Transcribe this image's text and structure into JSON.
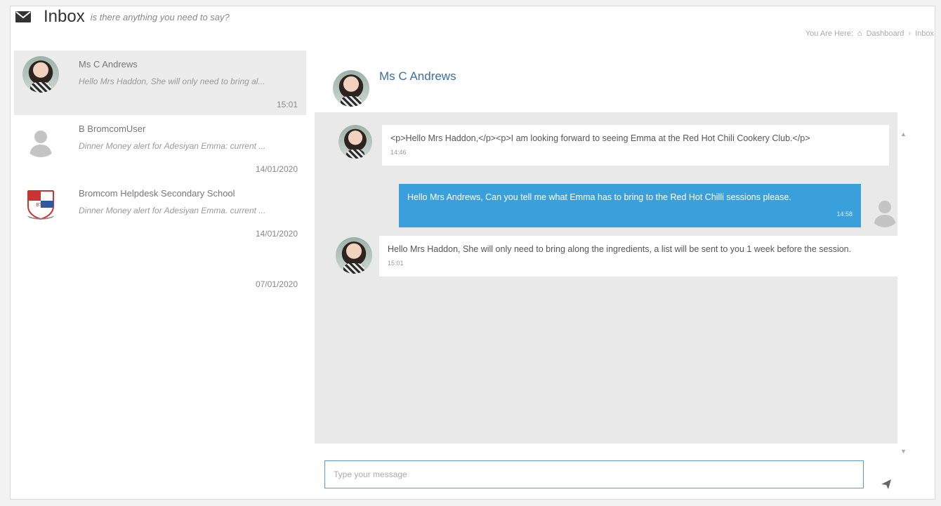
{
  "header": {
    "icon": "envelope-icon",
    "title": "Inbox",
    "subtitle": "is there anything you need to say?",
    "breadcrumb": {
      "prefix": "You Are Here:",
      "home_icon": "home-icon",
      "dashboard": "Dashboard",
      "current": "Inbox"
    }
  },
  "conversations": [
    {
      "name": "Ms C Andrews",
      "preview": "Hello Mrs Haddon, She will only need to bring al...",
      "time": "15:01",
      "avatar": "photo-avatar",
      "active": true
    },
    {
      "name": "B BromcomUser",
      "preview": "Dinner Money alert for Adesiyan Emma: current ...",
      "time": "14/01/2020",
      "avatar": "generic-user-icon"
    },
    {
      "name": "Bromcom Helpdesk Secondary School",
      "preview": "Dinner Money alert for Adesiyan Emma. current ...",
      "time": "14/01/2020",
      "avatar": "school-logo"
    },
    {
      "time": "07/01/2020"
    }
  ],
  "chat": {
    "contact_name": "Ms C Andrews",
    "messages": [
      {
        "direction": "in",
        "text": "<p>Hello Mrs Haddon,</p><p>I am looking forward to seeing Emma at the Red Hot Chili Cookery Club.</p>",
        "time": "14:46"
      },
      {
        "direction": "out",
        "text": "Hello Mrs Andrews, Can you tell me what Emma has to bring to the Red Hot Chilli sessions please.",
        "time": "14:58"
      },
      {
        "direction": "in",
        "text": "Hello Mrs Haddon, She will only need to bring along the ingredients, a list will be sent to you 1 week before the session.",
        "time": "15:01"
      }
    ],
    "composer": {
      "placeholder": "Type your message",
      "send_icon": "send-icon"
    }
  },
  "colors": {
    "accent": "#3aa0dc",
    "link": "#3a6ea5",
    "chat_bg": "#e9e9e9"
  }
}
